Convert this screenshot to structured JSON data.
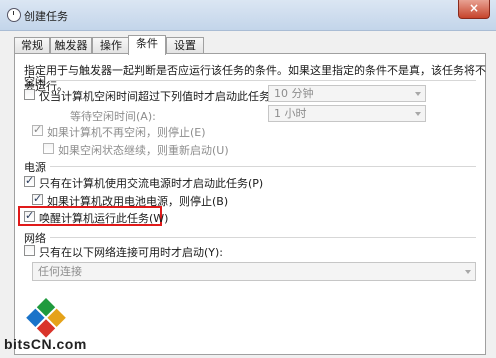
{
  "window": {
    "title": "创建任务",
    "close_glyph": "×"
  },
  "tabs": [
    {
      "label": "常规"
    },
    {
      "label": "触发器"
    },
    {
      "label": "操作"
    },
    {
      "label": "条件",
      "active": true
    },
    {
      "label": "设置"
    }
  ],
  "description": "指定用于与触发器一起判断是否应运行该任务的条件。如果这里指定的条件不是真，该任务将不会运行。",
  "idle": {
    "section_label": "空闲",
    "start_if_idle": {
      "label": "仅当计算机空闲时间超过下列值时才启动此任务(C):",
      "checked": false,
      "value": "10 分钟"
    },
    "wait_idle": {
      "label": "等待空闲时间(A):",
      "value": "1 小时"
    },
    "stop_if_not_idle": {
      "label": "如果计算机不再空闲，则停止(E)",
      "checked": true,
      "disabled": true
    },
    "restart_if_idle": {
      "label": "如果空闲状态继续，则重新启动(U)",
      "checked": false,
      "disabled": true
    }
  },
  "power": {
    "section_label": "电源",
    "ac_only": {
      "label": "只有在计算机使用交流电源时才启动此任务(P)",
      "checked": true
    },
    "stop_on_battery": {
      "label": "如果计算机改用电池电源，则停止(B)",
      "checked": true
    },
    "wake_to_run": {
      "label": "唤醒计算机运行此任务(W)",
      "checked": true
    }
  },
  "network": {
    "section_label": "网络",
    "only_if_network": {
      "label": "只有在以下网络连接可用时才启动(Y):",
      "checked": false
    },
    "connection": {
      "value": "任何连接"
    }
  },
  "watermark": {
    "text": "bitsCN.com"
  },
  "colors": {
    "highlight": "#e01a1a",
    "titlebar": "#c3d5ea",
    "close": "#c6442c"
  }
}
